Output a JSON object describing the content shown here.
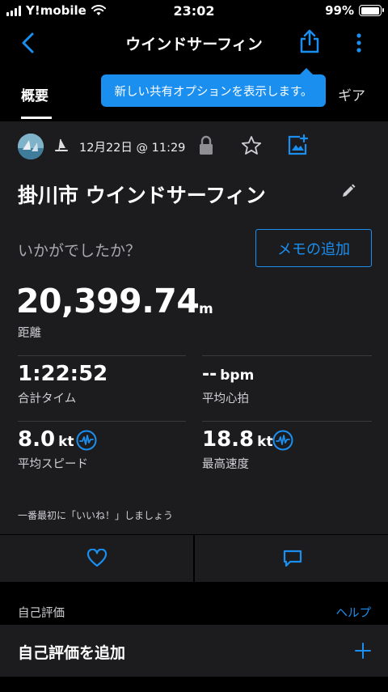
{
  "status_bar": {
    "carrier": "Y!mobile",
    "time": "23:02",
    "battery": "99%",
    "battery_level": 0.99
  },
  "nav": {
    "title": "ウインドサーフィン",
    "icons": [
      "back-icon",
      "share-icon",
      "more-icon"
    ]
  },
  "tabs": {
    "overview": "概要",
    "gear": "ギア"
  },
  "tooltip": "新しい共有オプションを表示します。",
  "activity": {
    "date": "12月22日 @ 11:29",
    "title": "掛川市 ウインドサーフィン",
    "prompt": "いかがでしたか？",
    "memo_button": "メモの追加",
    "distance_value": "20,399.74",
    "distance_unit": "m",
    "distance_label": "距離",
    "stats": {
      "total_time": {
        "value": "1:22:52",
        "label": "合計タイム"
      },
      "avg_hr": {
        "value": "--",
        "unit": "bpm",
        "label": "平均心拍"
      },
      "avg_speed": {
        "value": "8.0",
        "unit": "kt",
        "label": "平均スピード"
      },
      "max_speed": {
        "value": "18.8",
        "unit": "kt",
        "label": "最高速度"
      }
    },
    "like_prompt": "一番最初に「いいね！」しましょう"
  },
  "self_evaluation": {
    "section_label": "自己評価",
    "help": "ヘルプ",
    "add_label": "自己評価を追加"
  },
  "colors": {
    "accent": "#1b8ff0",
    "card": "#1c1c1e",
    "background": "#000000"
  }
}
